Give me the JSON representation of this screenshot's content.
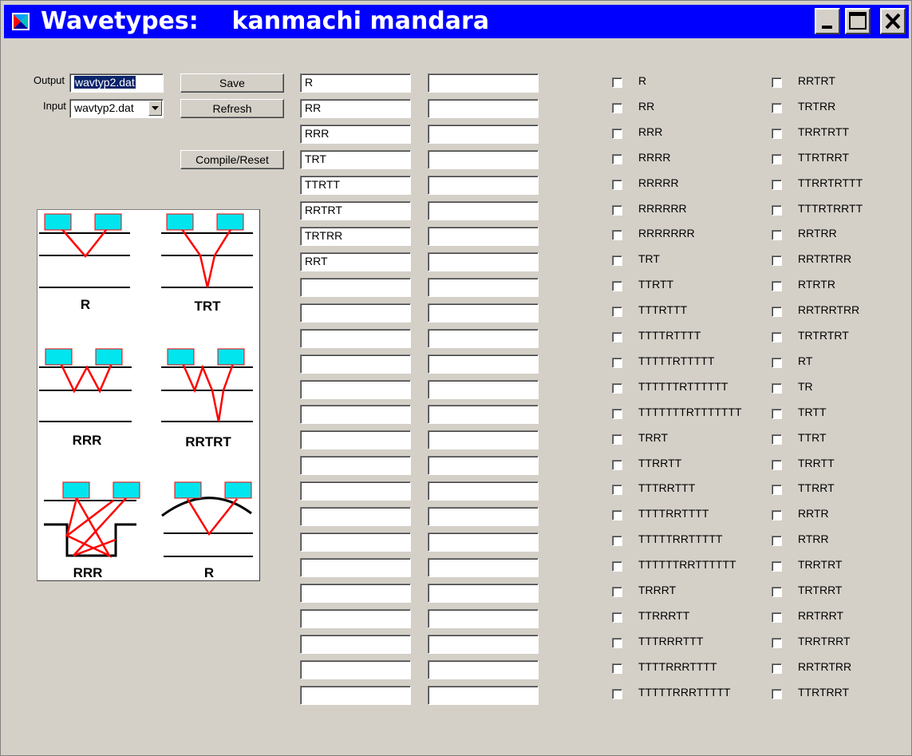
{
  "window": {
    "title": "Wavetypes:    kanmachi mandara"
  },
  "form": {
    "output_label": "Output",
    "output_value": "wavtyp2.dat",
    "input_label": "Input",
    "input_value": "wavtyp2.dat",
    "save_label": "Save",
    "refresh_label": "Refresh",
    "compile_label": "Compile/Reset"
  },
  "fields_col1": [
    "R",
    "RR",
    "RRR",
    "TRT",
    "TTRTT",
    "RRTRT",
    "TRTRR",
    "RRT",
    "",
    "",
    "",
    "",
    "",
    "",
    "",
    "",
    "",
    "",
    "",
    "",
    "",
    "",
    "",
    "",
    ""
  ],
  "fields_col2": [
    "",
    "",
    "",
    "",
    "",
    "",
    "",
    "",
    "",
    "",
    "",
    "",
    "",
    "",
    "",
    "",
    "",
    "",
    "",
    "",
    "",
    "",
    "",
    "",
    ""
  ],
  "checklist_col1": [
    "R",
    "RR",
    "RRR",
    "RRRR",
    "RRRRR",
    "RRRRRR",
    "RRRRRRR",
    "TRT",
    "TTRTT",
    "TTTRTTT",
    "TTTTRTTTT",
    "TTTTTRTTTTT",
    "TTTTTTRTTTTTT",
    "TTTTTTTRTTTTTTT",
    "TRRT",
    "TTRRTT",
    "TTTRRTTT",
    "TTTTRRTTTT",
    "TTTTTRRTTTTT",
    "TTTTTTRRTTTTTT",
    "TRRRT",
    "TTRRRTT",
    "TTTRRRTTT",
    "TTTTRRRTTTT",
    "TTTTTRRRTTTTT"
  ],
  "checklist_col2": [
    "RRTRT",
    "TRTRR",
    "TRRTRTT",
    "TTRTRRT",
    "TTRRTRTTT",
    "TTTRTRRTT",
    "RRTRR",
    "RRTRTRR",
    "RTRTR",
    "RRTRRTRR",
    "TRTRTRT",
    "RT",
    "TR",
    "TRTT",
    "TTRT",
    "TRRTT",
    "TTRRT",
    "RRTR",
    "RTRR",
    "TRRTRT",
    "TRTRRT",
    "RRTRRT",
    "TRRTRRT",
    "RRTRTRR",
    "TTRTRRT"
  ],
  "diagram": {
    "labels": [
      "R",
      "TRT",
      "RRR",
      "RRTRT",
      "RRR",
      "R"
    ],
    "colors": {
      "receiver": "#00e5ee",
      "ray": "#ff0000",
      "layer": "#000000"
    }
  }
}
